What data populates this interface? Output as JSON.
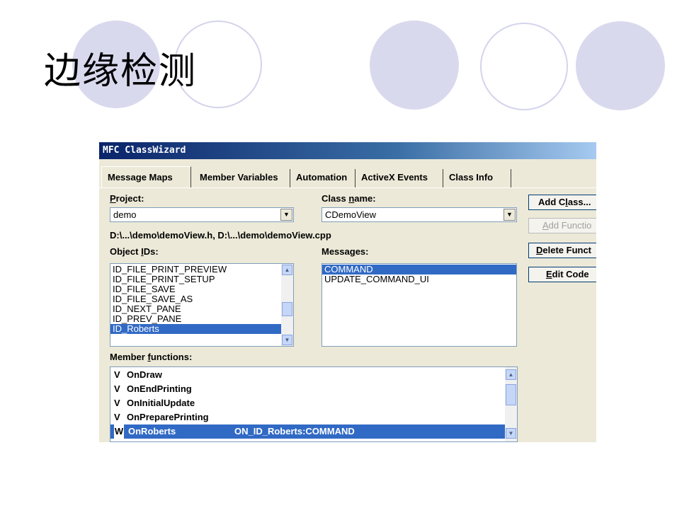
{
  "slide": {
    "title": "边缘检测"
  },
  "window": {
    "title": "MFC ClassWizard"
  },
  "tabs": [
    {
      "label": "Message Maps"
    },
    {
      "label": "Member Variables"
    },
    {
      "label": "Automation"
    },
    {
      "label": "ActiveX Events"
    },
    {
      "label": "Class Info"
    }
  ],
  "project": {
    "label_u": "P",
    "label_rest": "roject:",
    "value": "demo"
  },
  "class_name": {
    "label_pre": "Class ",
    "label_u": "n",
    "label_rest": "ame:",
    "value": "CDemoView"
  },
  "file_path": "D:\\...\\demo\\demoView.h, D:\\...\\demo\\demoView.cpp",
  "object_ids": {
    "label_pre": "Object ",
    "label_u": "I",
    "label_rest": "Ds:",
    "items": [
      "ID_FILE_PRINT_PREVIEW",
      "ID_FILE_PRINT_SETUP",
      "ID_FILE_SAVE",
      "ID_FILE_SAVE_AS",
      "ID_NEXT_PANE",
      "ID_PREV_PANE",
      "ID_Roberts"
    ],
    "selected": "ID_Roberts"
  },
  "messages": {
    "label_pre": "Messa",
    "label_u": "g",
    "label_rest": "es:",
    "items": [
      "COMMAND",
      "UPDATE_COMMAND_UI"
    ],
    "selected": "COMMAND"
  },
  "member_functions": {
    "label_pre": "Member ",
    "label_u": "f",
    "label_rest": "unctions:",
    "items": [
      {
        "badge": "V",
        "name": "OnDraw",
        "handler": ""
      },
      {
        "badge": "V",
        "name": "OnEndPrinting",
        "handler": ""
      },
      {
        "badge": "V",
        "name": "OnInitialUpdate",
        "handler": ""
      },
      {
        "badge": "V",
        "name": "OnPreparePrinting",
        "handler": ""
      },
      {
        "badge": "W",
        "name": "OnRoberts",
        "handler": "ON_ID_Roberts:COMMAND"
      }
    ]
  },
  "buttons": {
    "add_class": {
      "pre": "Add C",
      "u": "l",
      "rest": "ass..."
    },
    "add_function": {
      "u": "A",
      "rest": "dd Functio"
    },
    "delete_function": {
      "u": "D",
      "rest": "elete Funct"
    },
    "edit_code": {
      "u": "E",
      "rest": "dit Code"
    }
  },
  "colors": {
    "accent_circle": "#d9d9ee",
    "selection": "#316ac5",
    "dialog_face": "#ece9d8"
  },
  "icons": {
    "dropdown": "chevron-down-icon",
    "scroll_up": "scroll-up-icon",
    "scroll_down": "scroll-down-icon"
  }
}
